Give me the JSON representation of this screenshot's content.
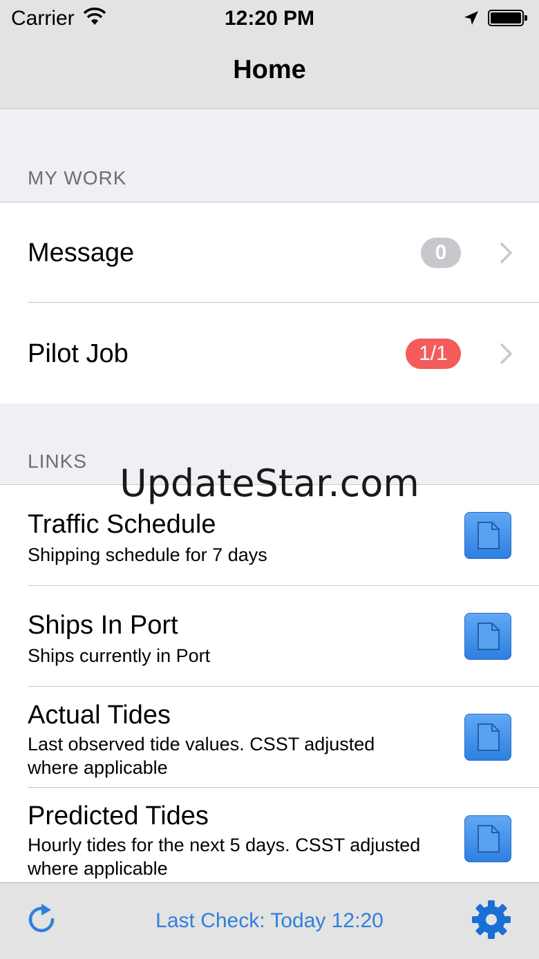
{
  "status_bar": {
    "carrier": "Carrier",
    "time": "12:20 PM"
  },
  "nav": {
    "title": "Home"
  },
  "my_work": {
    "header": "MY WORK",
    "items": [
      {
        "label": "Message",
        "badge": "0",
        "badge_color": "#c7c7cc"
      },
      {
        "label": "Pilot Job",
        "badge": "1/1",
        "badge_color": "#f45b5b"
      }
    ]
  },
  "links": {
    "header": "LINKS",
    "items": [
      {
        "title": "Traffic Schedule",
        "subtitle": "Shipping schedule for 7 days"
      },
      {
        "title": "Ships In Port",
        "subtitle": "Ships currently in Port"
      },
      {
        "title": "Actual Tides",
        "subtitle": "Last observed tide values. CSST adjusted where applicable"
      },
      {
        "title": "Predicted Tides",
        "subtitle": "Hourly tides for the next 5 days. CSST adjusted where applicable"
      }
    ]
  },
  "watermark": "UpdateStar.com",
  "toolbar": {
    "last_check": "Last Check: Today 12:20"
  },
  "colors": {
    "accent": "#2f7fdc",
    "doc_button": "#3d8ee8"
  },
  "icons": [
    "wifi-icon",
    "location-arrow-icon",
    "battery-icon",
    "chevron-right-icon",
    "document-icon",
    "refresh-icon",
    "gear-icon"
  ]
}
